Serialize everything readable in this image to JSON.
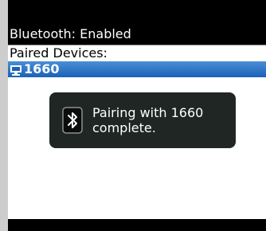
{
  "status": {
    "bluetooth_label": "Bluetooth: Enabled"
  },
  "paired": {
    "header": "Paired Devices:",
    "devices": [
      {
        "name": "1660",
        "icon": "computer-icon",
        "selected": true
      }
    ]
  },
  "toast": {
    "icon": "bluetooth-icon",
    "message": "Pairing with 1660 complete."
  },
  "colors": {
    "selection": "#1b62b8",
    "toast_bg": "#202624",
    "bar_bg": "#000000"
  }
}
